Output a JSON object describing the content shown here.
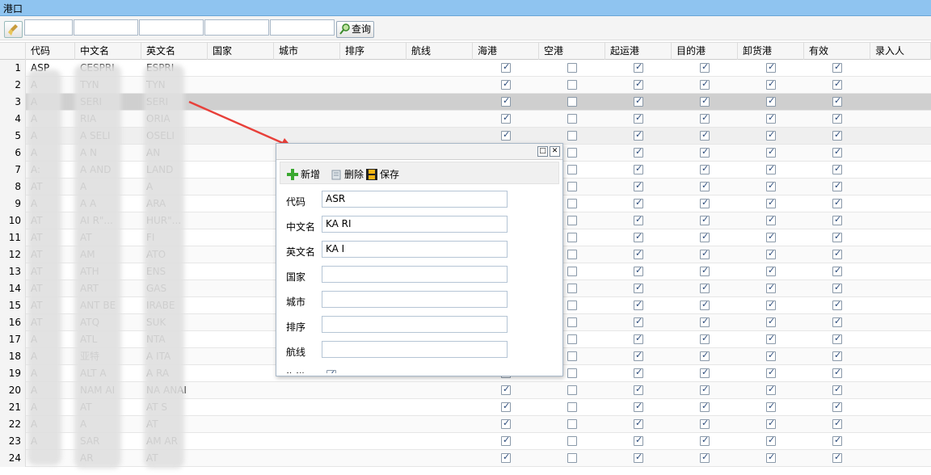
{
  "panel": {
    "title": "港口"
  },
  "toolbar": {
    "filters": [
      "",
      "",
      "",
      "",
      ""
    ],
    "query_label": "查询"
  },
  "columns": [
    "代码",
    "中文名",
    "英文名",
    "国家",
    "城市",
    "排序",
    "航线",
    "海港",
    "空港",
    "起运港",
    "目的港",
    "卸货港",
    "有效",
    "录入人"
  ],
  "rows": [
    {
      "n": "1",
      "code": "ASP",
      "cn": "CESPRI",
      "en": "ESPRI",
      "sea": true,
      "air": false
    },
    {
      "n": "2",
      "code": "A",
      "cn": "TYN",
      "en": "TYN",
      "sea": true,
      "air": false
    },
    {
      "n": "3",
      "code": "A",
      "cn": "SERI",
      "en": "SERI",
      "sea": true,
      "air": false
    },
    {
      "n": "4",
      "code": "A",
      "cn": "RIA",
      "en": "ORIA",
      "sea": true,
      "air": false
    },
    {
      "n": "5",
      "code": "A",
      "cn": "A    SELI",
      "en": "OSELI",
      "sea": true,
      "air": false
    },
    {
      "n": "6",
      "code": "A",
      "cn": "A      N",
      "en": "AN",
      "sea": true,
      "air": false
    },
    {
      "n": "7",
      "code": "A:",
      "cn": "A      AND",
      "en": "LAND",
      "sea": true,
      "air": false
    },
    {
      "n": "8",
      "code": "AT",
      "cn": "A",
      "en": "A",
      "sea": true,
      "air": false
    },
    {
      "n": "9",
      "code": "A",
      "cn": "A       A",
      "en": "ARA",
      "sea": true,
      "air": false
    },
    {
      "n": "10",
      "code": "AT",
      "cn": "AI     R\"...",
      "en": "HUR\"...",
      "sea": true,
      "air": false
    },
    {
      "n": "11",
      "code": "AT",
      "cn": "AT",
      "en": "FI",
      "sea": true,
      "air": false
    },
    {
      "n": "12",
      "code": "AT",
      "cn": "AM",
      "en": "ATO",
      "sea": true,
      "air": false
    },
    {
      "n": "13",
      "code": "AT",
      "cn": "ATH",
      "en": "ENS",
      "sea": true,
      "air": false
    },
    {
      "n": "14",
      "code": "AT",
      "cn": "ART",
      "en": "GAS",
      "sea": true,
      "air": false
    },
    {
      "n": "15",
      "code": "AT",
      "cn": "ANT      BE",
      "en": "IRABE",
      "sea": true,
      "air": false
    },
    {
      "n": "16",
      "code": "AT",
      "cn": "ATQ",
      "en": "SUK",
      "sea": true,
      "air": false
    },
    {
      "n": "17",
      "code": "A",
      "cn": "ATL",
      "en": "NTA",
      "sea": true,
      "air": false
    },
    {
      "n": "18",
      "code": "A",
      "cn": "亚特",
      "en": "A      ITA",
      "sea": true,
      "air": false
    },
    {
      "n": "19",
      "code": "A",
      "cn": "ALT       A",
      "en": "A       RA",
      "sea": true,
      "air": false
    },
    {
      "n": "20",
      "code": "A",
      "cn": "NAM     AI",
      "en": "NA     ANAI",
      "sea": true,
      "air": false
    },
    {
      "n": "21",
      "code": "A",
      "cn": "AT",
      "en": "AT       S",
      "sea": true,
      "air": false
    },
    {
      "n": "22",
      "code": "A",
      "cn": "A",
      "en": "AT",
      "sea": true,
      "air": false
    },
    {
      "n": "23",
      "code": "A",
      "cn": "     SAR",
      "en": "AM      AR",
      "sea": true,
      "air": false
    },
    {
      "n": "24",
      "code": "",
      "cn": "AR",
      "en": "AT",
      "sea": true,
      "air": false
    }
  ],
  "dialog": {
    "toolbar": {
      "add_label": "新增",
      "delete_label": "删除",
      "save_label": "保存"
    },
    "fields": [
      {
        "label": "代码",
        "value": "ASR"
      },
      {
        "label": "中文名",
        "value": "KA      RI"
      },
      {
        "label": "英文名",
        "value": "KA       I"
      },
      {
        "label": "国家",
        "value": ""
      },
      {
        "label": "城市",
        "value": ""
      },
      {
        "label": "排序",
        "value": ""
      },
      {
        "label": "航线",
        "value": ""
      }
    ],
    "seaport_label": "海港",
    "seaport_checked": true
  },
  "colors": {
    "header_bg": "#8fc4f0",
    "arrow": "#e8403a",
    "selected_row": "#cfcfcf"
  }
}
